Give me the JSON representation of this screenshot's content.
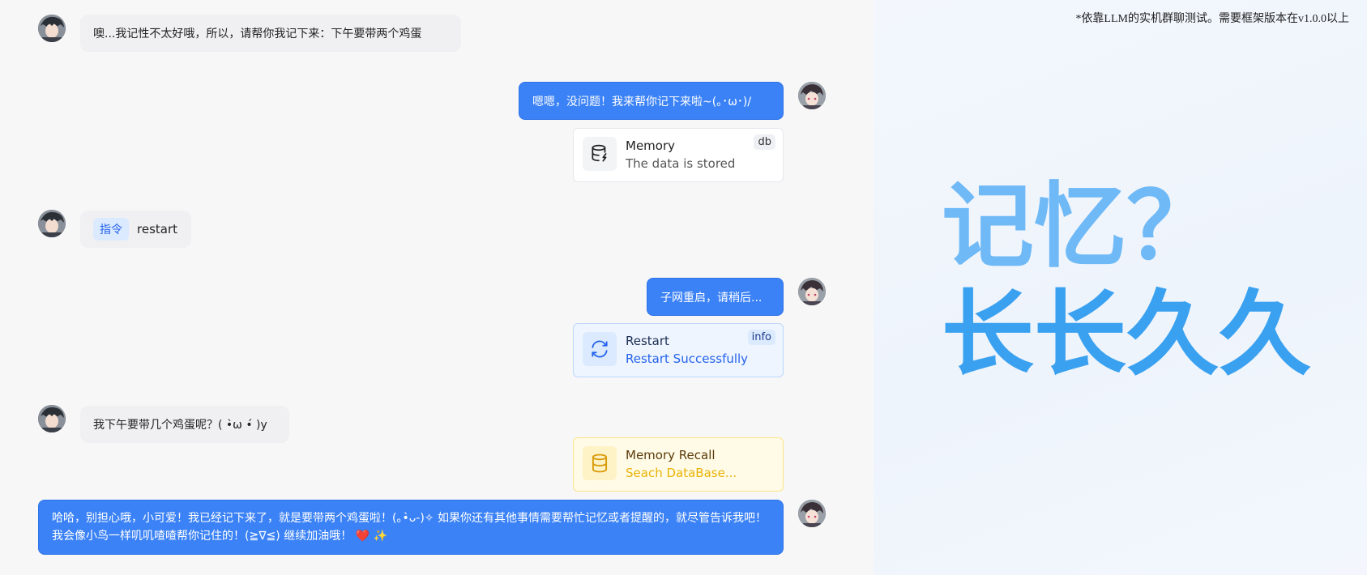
{
  "chat": {
    "messages": [
      {
        "role": "user",
        "text": "噢...我记性不太好哦，所以，请帮你我记下来：下午要带两个鸡蛋"
      },
      {
        "role": "bot",
        "text": "嗯嗯，没问题！我来帮你记下来啦~(｡･ω･)/"
      },
      {
        "role": "card",
        "title": "Memory",
        "subtitle": "The data is stored",
        "tag": "db",
        "icon": "database-lightning-icon"
      },
      {
        "role": "user-command",
        "command_tag": "指令",
        "text": "restart"
      },
      {
        "role": "bot",
        "text": "子网重启，请稍后..."
      },
      {
        "role": "card",
        "title": "Restart",
        "subtitle": "Restart Successfully",
        "tag": "info",
        "icon": "refresh-icon"
      },
      {
        "role": "user",
        "text": "我下午要带几个鸡蛋呢？( •̀ω •́ )y"
      },
      {
        "role": "card",
        "title": "Memory Recall",
        "subtitle": "Seach DataBase...",
        "icon": "database-icon"
      },
      {
        "role": "bot",
        "text": "哈哈，别担心哦，小可爱！我已经记下来了，就是要带两个鸡蛋啦！(｡•̀ᴗ-)✧ 如果你还有其他事情需要帮忙记忆或者提醒的，就尽管告诉我吧！ 我会像小鸟一样叽叽喳喳帮你记住的！(≧∇≦) 继续加油哦！ ❤️ ✨"
      }
    ]
  },
  "promo": {
    "note": "*依靠LLM的实机群聊测试。需要框架版本在v1.0.0以上",
    "headline_line1": "记忆？",
    "headline_line2": "长长久久"
  },
  "colors": {
    "bot_bubble": "#3b82f6",
    "headline_light": "#6fb9f7",
    "headline_dark": "#3aa1f0",
    "info_accent": "#2563eb",
    "recall_accent": "#eab308"
  }
}
